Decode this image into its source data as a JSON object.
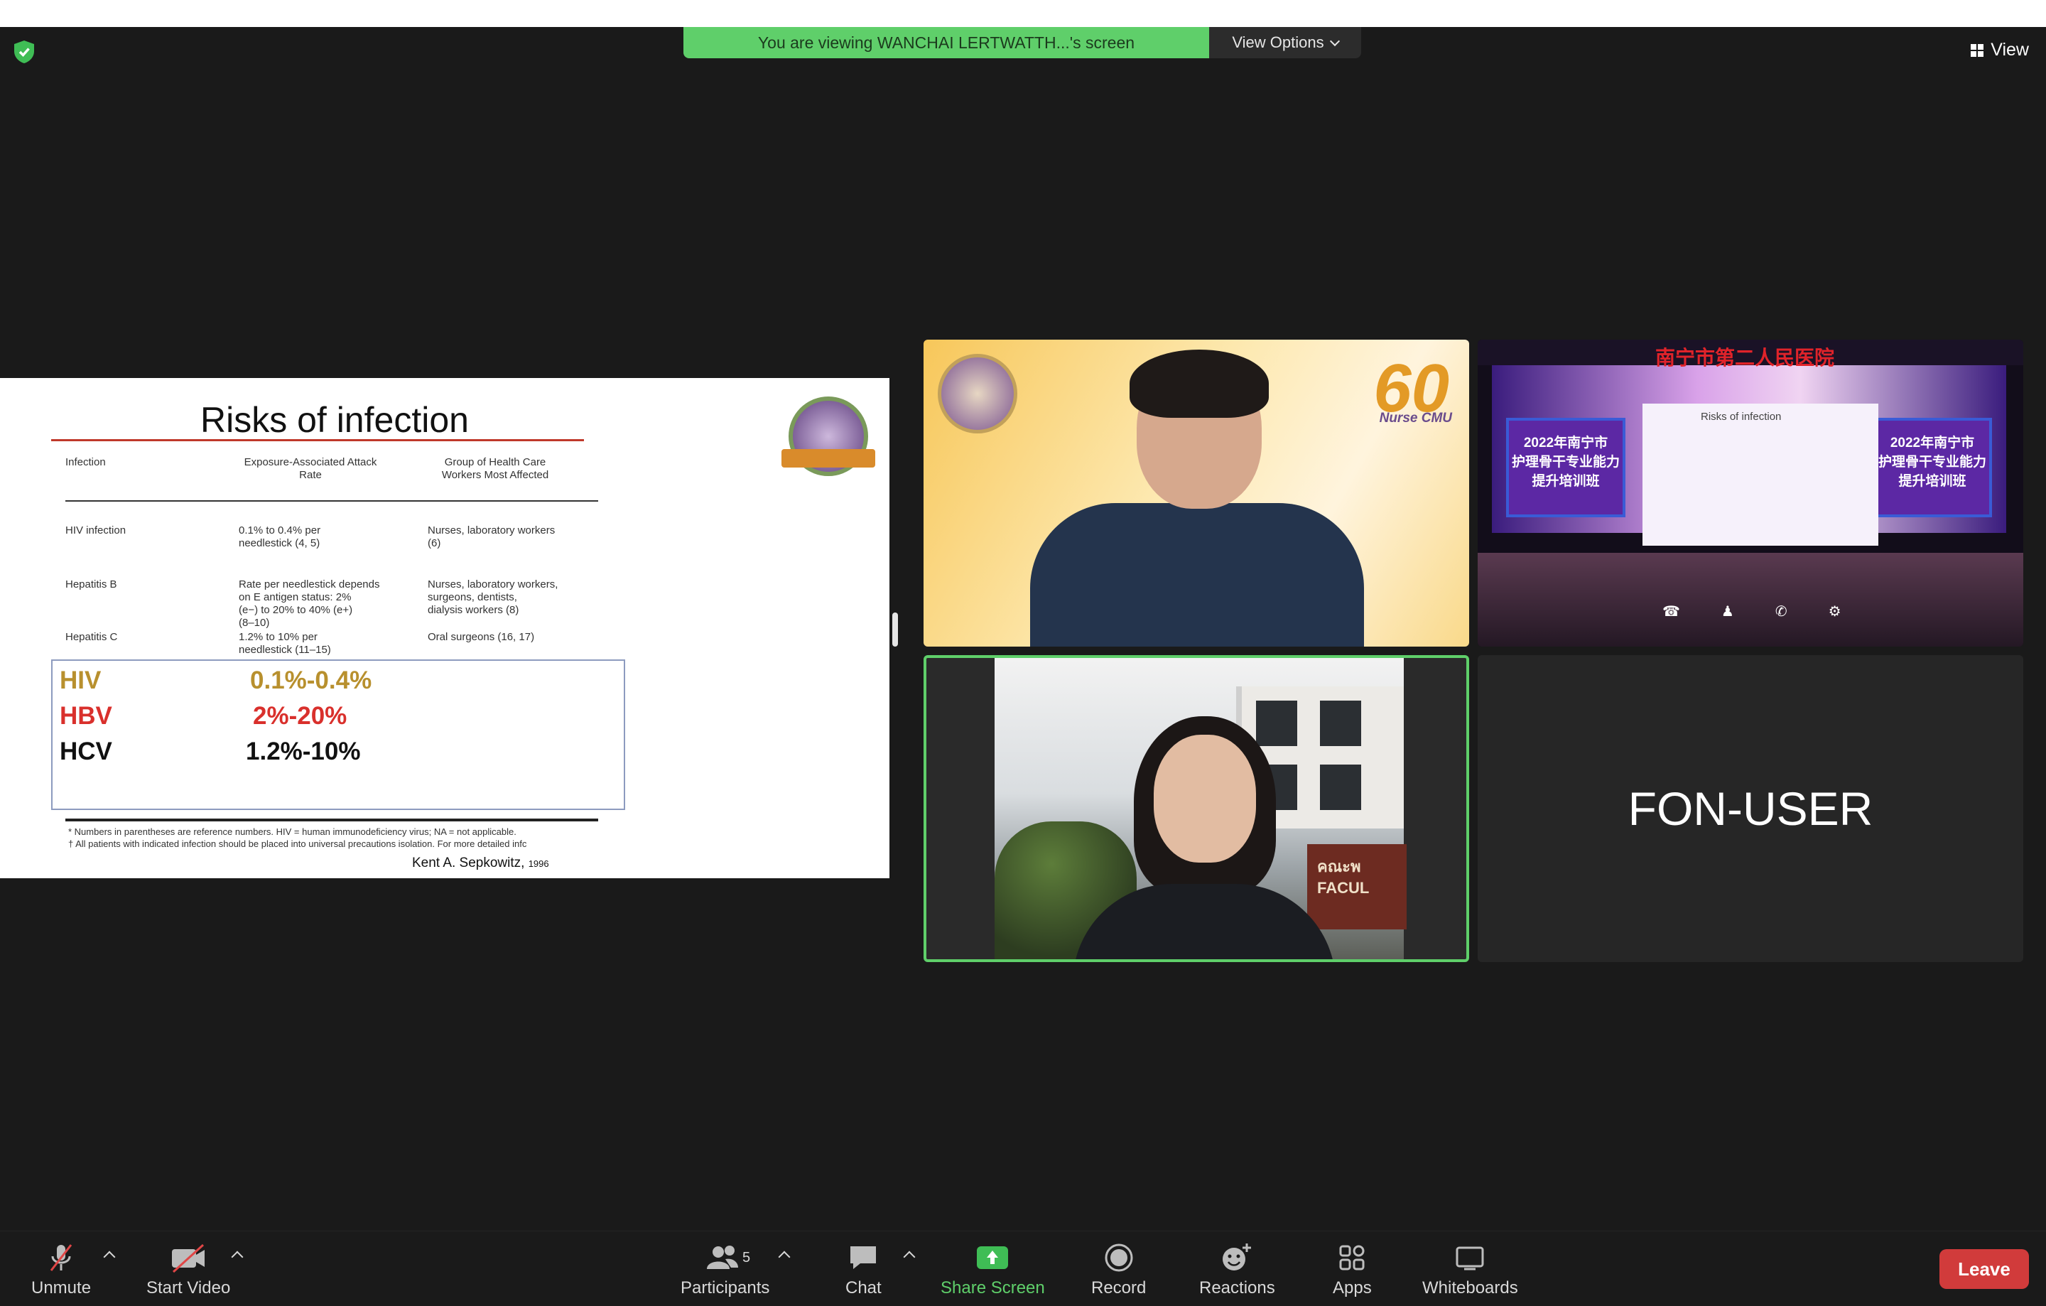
{
  "banner": {
    "viewing_text": "You are viewing WANCHAI LERTWATTH...'s screen",
    "view_options_label": "View Options"
  },
  "top_right": {
    "view_label": "View"
  },
  "slide": {
    "title": "Risks of infection",
    "table": {
      "headers": [
        "Infection",
        "Exposure-Associated Attack\nRate",
        "Group of Health Care\nWorkers Most Affected"
      ],
      "rows": [
        [
          "HIV infection",
          "0.1% to 0.4% per\n   needlestick (4, 5)",
          "Nurses, laboratory workers\n   (6)"
        ],
        [
          "Hepatitis B",
          "Rate per needlestick depends\n   on E antigen status: 2%\n   (e−) to 20% to 40% (e+)\n   (8–10)",
          "Nurses, laboratory workers,\n   surgeons, dentists,\n   dialysis workers (8)"
        ],
        [
          "Hepatitis C",
          "1.2% to 10% per\n   needlestick (11–15)",
          "Oral surgeons (16, 17)"
        ]
      ]
    },
    "summary": [
      {
        "label": "HIV",
        "value": "0.1%-0.4%",
        "color": "#b8902e"
      },
      {
        "label": "HBV",
        "value": "2%-20%",
        "color": "#d9302c"
      },
      {
        "label": "HCV",
        "value": "1.2%-10%",
        "color": "#111111"
      }
    ],
    "footnotes": [
      "* Numbers in parentheses are reference numbers. HIV = human immunodeficiency virus; NA = not applicable.",
      "† All patients with indicated infection should be placed into universal precautions isolation. For more detailed infc"
    ],
    "citation": "Kent A. Sepkowitz,",
    "citation_year": "1996"
  },
  "tiles": {
    "presenter_badge_number": "60",
    "presenter_badge_sub": "Nurse CMU",
    "stage_title": "南宁市第二人民医院",
    "stage_panel_text": "2022年南宁市\n护理骨干专业能力\n提升培训班",
    "stage_slide_title": "Risks of infection",
    "sign_text": "คณะพ\nFACUL",
    "fon_user_name": "FON-USER"
  },
  "toolbar": {
    "unmute": "Unmute",
    "start_video": "Start Video",
    "participants": "Participants",
    "participants_count": "5",
    "chat": "Chat",
    "share_screen": "Share Screen",
    "record": "Record",
    "reactions": "Reactions",
    "apps": "Apps",
    "whiteboards": "Whiteboards",
    "leave": "Leave"
  },
  "colors": {
    "banner_green": "#5fcf6a",
    "leave_red": "#d13b3b",
    "active_speaker_border": "#5fcf6a"
  }
}
